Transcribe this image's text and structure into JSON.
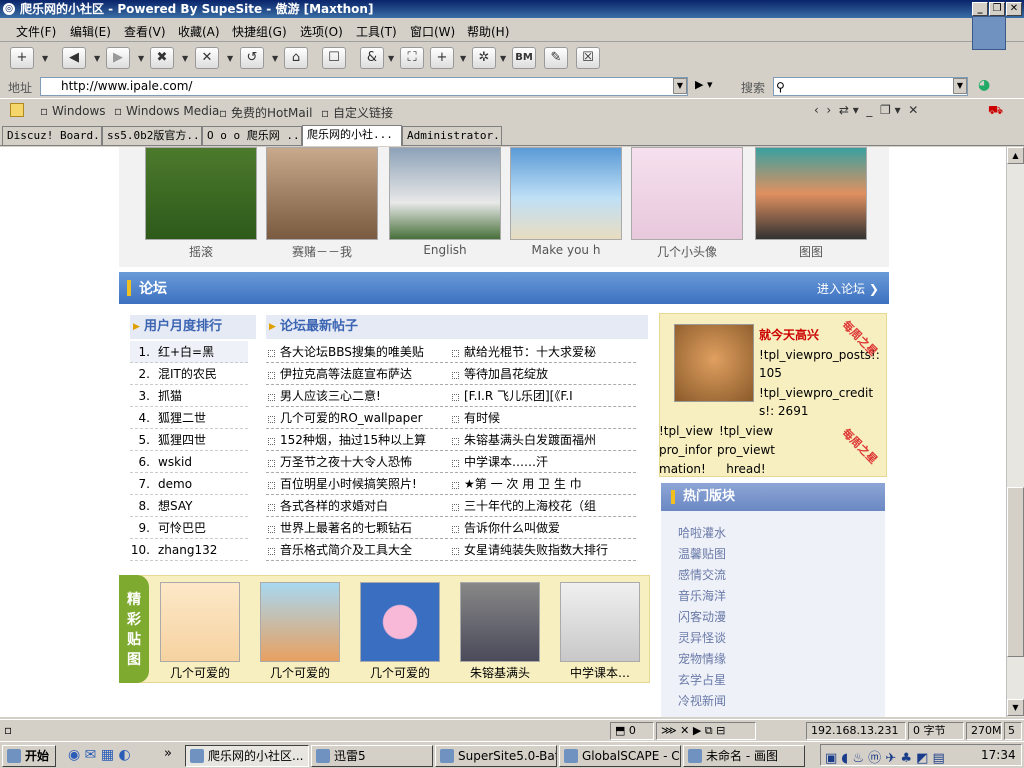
{
  "window": {
    "title": "爬乐网的小社区 - Powered By SupeSite - 傲游 [Maxthon]",
    "minimize": "_",
    "restore": "❐",
    "close": "✕"
  },
  "menu": [
    "文件(F)",
    "编辑(E)",
    "查看(V)",
    "收藏(A)",
    "快捷组(G)",
    "选项(O)",
    "工具(T)",
    "窗口(W)",
    "帮助(H)"
  ],
  "toolbar": {
    "icons": [
      "new-tab-icon",
      "back-icon",
      "forward-icon",
      "close-tab-icon",
      "stop-icon",
      "refresh-icon",
      "home-icon",
      "book-icon",
      "undo-icon",
      "fullscreen-icon",
      "add-icon",
      "plugin-icon",
      "bm-icon",
      "tools-icon",
      "close-all-icon"
    ],
    "bm_label": "BM"
  },
  "address": {
    "label": "地址",
    "url": "http://www.ipale.com/",
    "search_label": "搜索",
    "search_value": ""
  },
  "links": [
    "Windows",
    "Windows Media",
    "免费的HotMail",
    "自定义链接"
  ],
  "tabs": [
    "Discuz! Board...",
    "ss5.0b2版官方...",
    "O o o  爬乐网 ...",
    "爬乐网的小社...",
    "Administrator..."
  ],
  "photos": [
    "摇滚",
    "赛赌－－我",
    "English",
    "Make you h",
    "几个小头像",
    "图图"
  ],
  "forum": {
    "title": "论坛",
    "enter": "进入论坛"
  },
  "ranking": {
    "heading": "用户月度排行",
    "users": [
      "红+白=黑",
      "混IT的农民",
      "抓猫",
      "狐狸二世",
      "狐狸四世",
      "wskid",
      "demo",
      "想SAY",
      "可怜巴巴",
      "zhang132"
    ]
  },
  "posts": {
    "heading": "论坛最新帖子",
    "left": [
      "各大论坛BBS搜集的唯美贴",
      "伊拉克高等法庭宣布萨达",
      "男人应该三心二意!",
      "几个可爱的RO_wallpaper",
      "152种烟，抽过15种以上算",
      "万圣节之夜十大令人恐怖",
      "百位明星小时候搞笑照片!",
      "各式各样的求婚对白",
      "世界上最著名的七颗钻石",
      "音乐格式简介及工具大全"
    ],
    "right": [
      "献给光棍节：十大求爱秘",
      "等待加昌花绽放",
      "[F.I.R 飞儿乐团][《F.I",
      "有时候",
      "朱镕基满头白发踱面福州",
      "中学课本……汗",
      "★第 一 次 用 卫 生 巾",
      "三十年代的上海校花（组",
      "告诉你什么叫做爱",
      "女星请纯装失败指数大排行"
    ]
  },
  "user_panel": {
    "name": "就今天高兴",
    "posts": "!tpl_viewpro_posts!: 105",
    "credits": "!tpl_viewpro_credits!: 2691",
    "info_link": "!tpl_viewpro_information!",
    "read_link": "!tpl_viewpro_viewthread!",
    "week_star_1": "每周之星",
    "week_star_2": "每周之星"
  },
  "hot_sections": {
    "heading": "热门版块",
    "items": [
      "哈啦灌水",
      "温馨贴图",
      "感情交流",
      "音乐海洋",
      "闪客动漫",
      "灵异怪谈",
      "宠物情缘",
      "玄学占星",
      "冷视新闻"
    ]
  },
  "featured": {
    "label": [
      "精",
      "彩",
      "贴",
      "图"
    ],
    "captions": [
      "几个可爱的",
      "几个可爱的",
      "几个可爱的",
      "朱镕基满头",
      "中学课本…"
    ]
  },
  "status": {
    "count": "0",
    "ip": "192.168.13.231",
    "bytes": "0 字节",
    "memory": "270M",
    "number": "5"
  },
  "taskbar": {
    "start": "开始",
    "chevron": "»",
    "tasks": [
      "爬乐网的小社区...",
      "迅雷5",
      "SuperSite5.0-Bat...",
      "GlobalSCAPE - Cu...",
      "未命名 - 画图"
    ],
    "clock": "17:34"
  }
}
